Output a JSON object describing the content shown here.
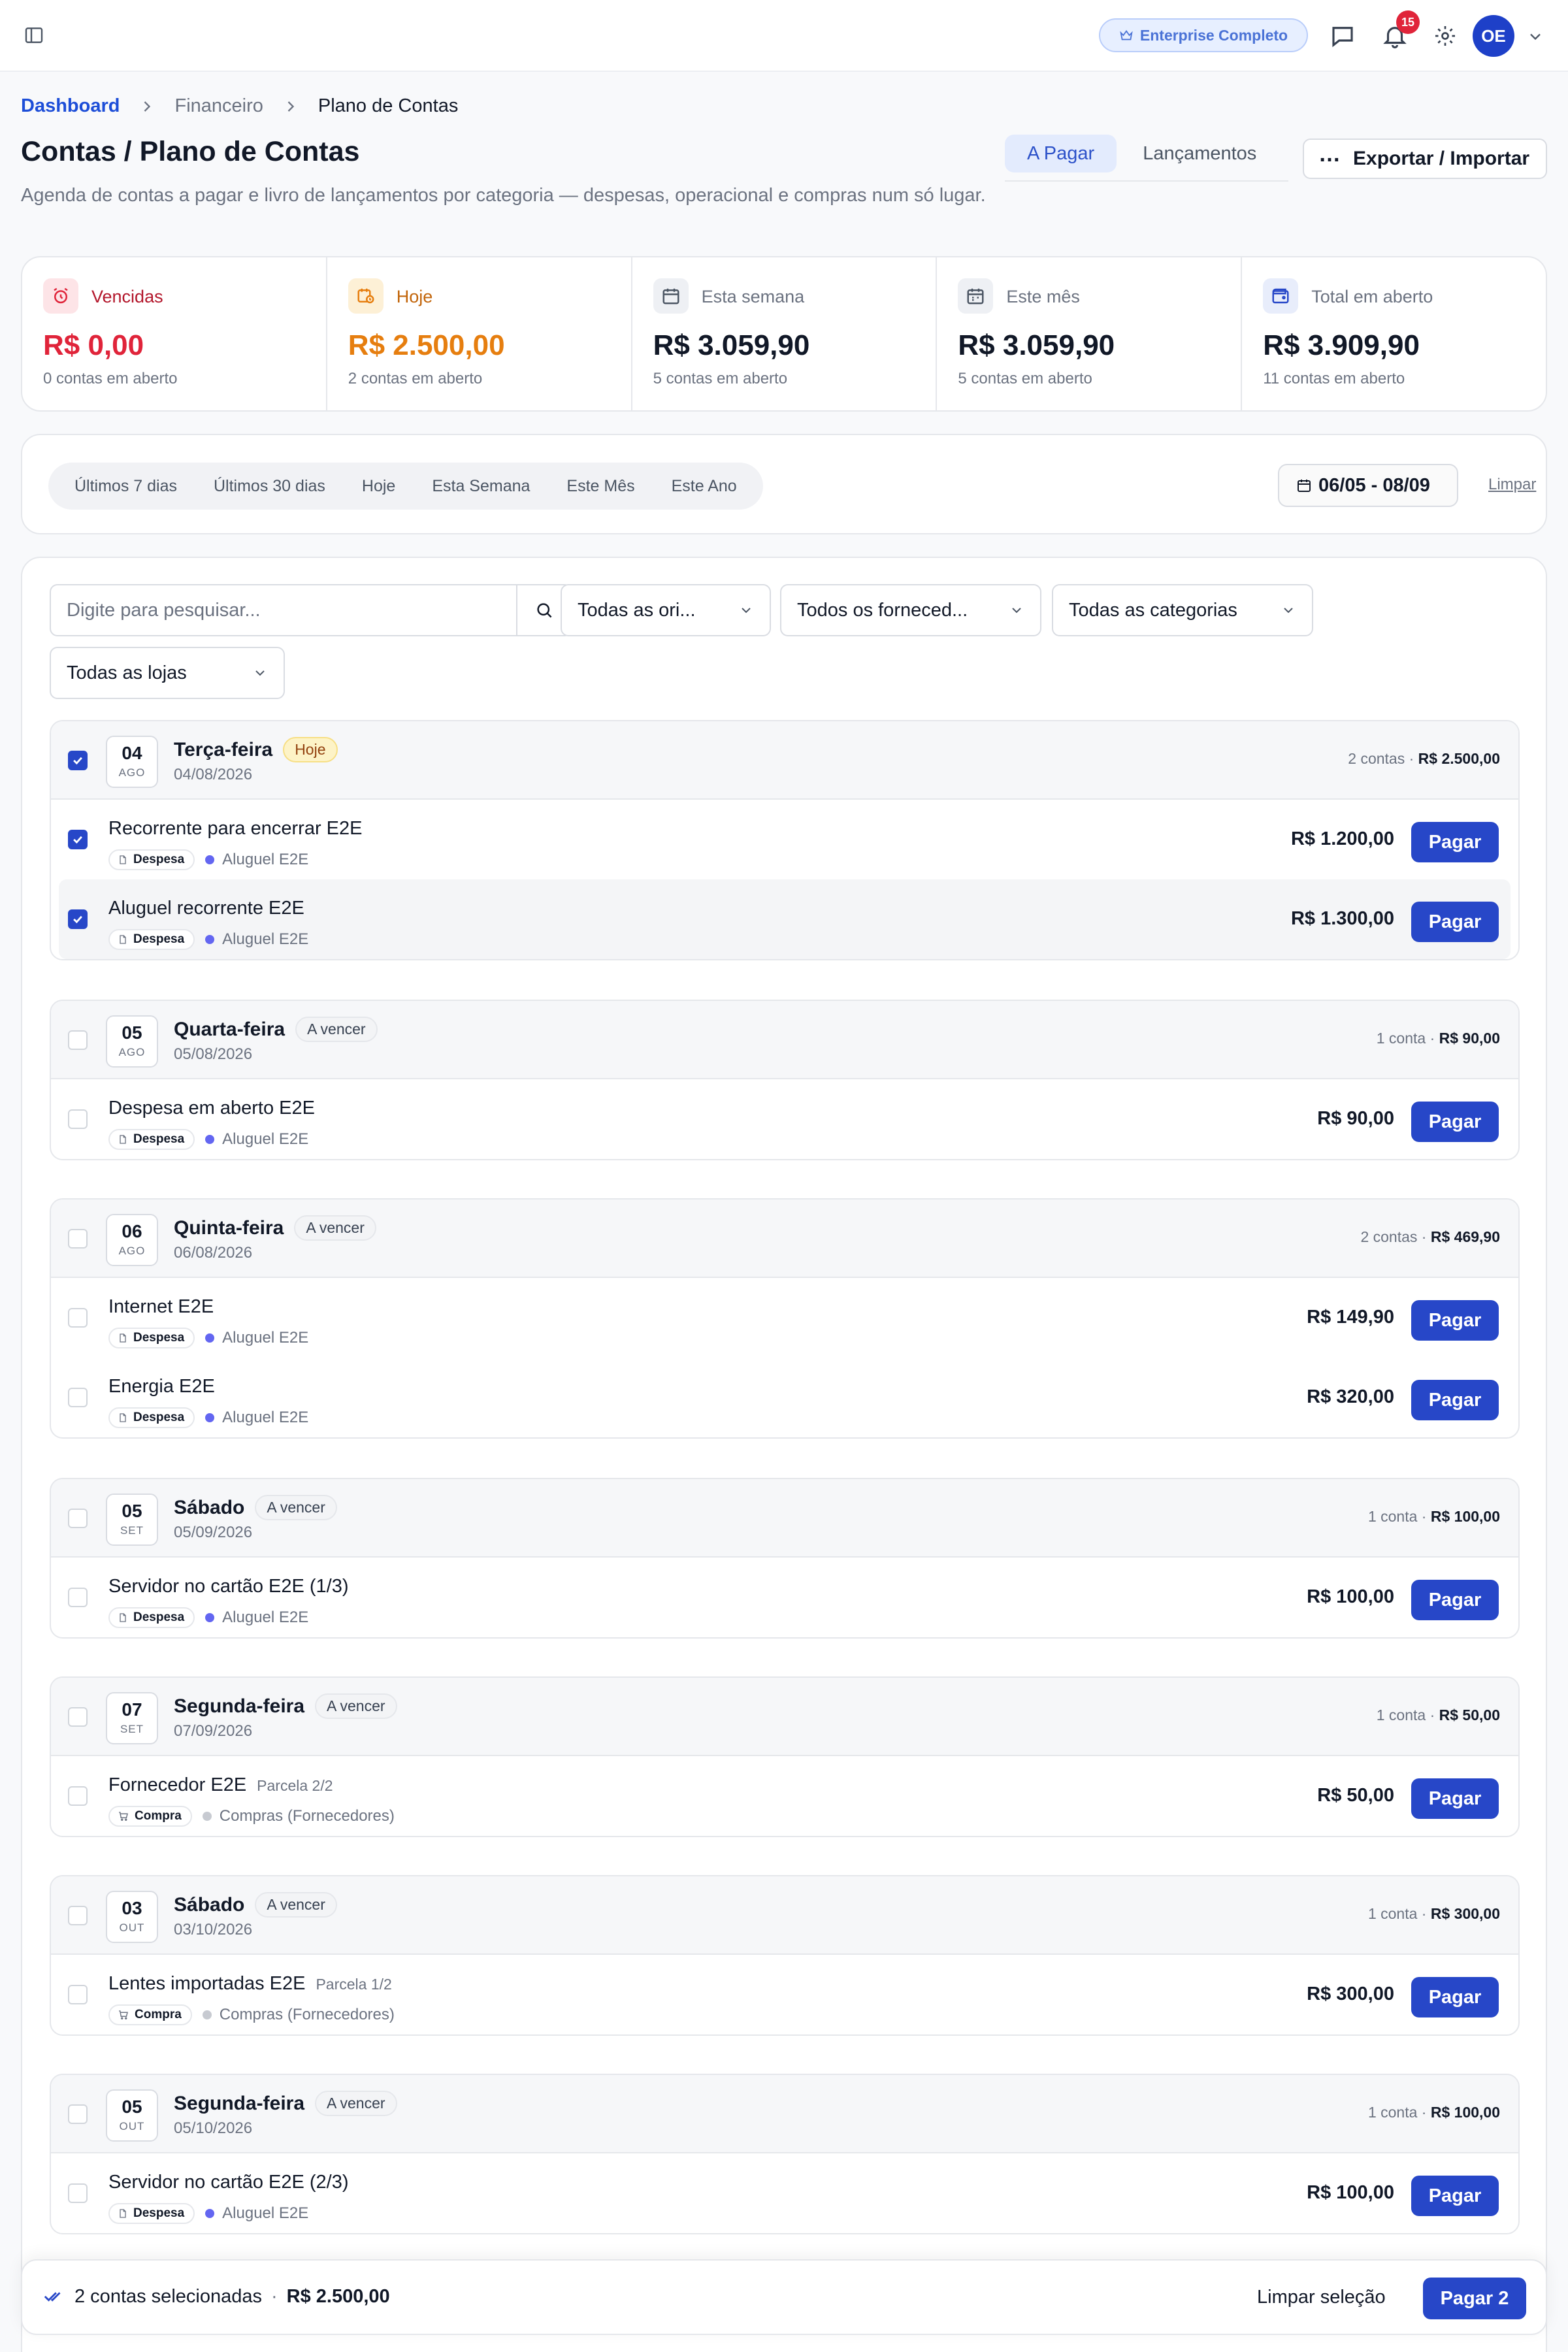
{
  "topbar": {
    "plan_badge": "Enterprise Completo",
    "notification_count": "15",
    "avatar_initials": "OE"
  },
  "breadcrumb": [
    "Dashboard",
    "Financeiro",
    "Plano de Contas"
  ],
  "header": {
    "title": "Contas / Plano de Contas",
    "description": "Agenda de contas a pagar e livro de lançamentos por categoria — despesas, operacional e compras num só lugar.",
    "tabs": [
      {
        "label": "A Pagar",
        "active": true
      },
      {
        "label": "Lançamentos",
        "active": false
      }
    ],
    "export_label": "Exportar / Importar"
  },
  "stats": [
    {
      "label": "Vencidas",
      "value": "R$ 0,00",
      "sub": "0 contas em aberto",
      "icon": "alarm-icon",
      "color": "#e0243a"
    },
    {
      "label": "Hoje",
      "value": "R$ 2.500,00",
      "sub": "2 contas em aberto",
      "icon": "calendar-clock-icon",
      "color": "#e67e0f"
    },
    {
      "label": "Esta semana",
      "value": "R$ 3.059,90",
      "sub": "5 contas em aberto",
      "icon": "calendar-icon",
      "color": "#111827"
    },
    {
      "label": "Este mês",
      "value": "R$ 3.059,90",
      "sub": "5 contas em aberto",
      "icon": "calendar-icon",
      "color": "#111827"
    },
    {
      "label": "Total em aberto",
      "value": "R$ 3.909,90",
      "sub": "11 contas em aberto",
      "icon": "wallet-icon",
      "color": "#111827"
    }
  ],
  "period": {
    "pills": [
      "Últimos 7 dias",
      "Últimos 30 dias",
      "Hoje",
      "Esta Semana",
      "Este Mês",
      "Este Ano"
    ],
    "date_range": "06/05 - 08/09",
    "clear_label": "Limpar"
  },
  "filters": {
    "search_placeholder": "Digite para pesquisar...",
    "origins": "Todas as ori...",
    "suppliers": "Todos os forneced...",
    "categories": "Todas as categorias",
    "stores": "Todas as lojas"
  },
  "days": [
    {
      "day": "04",
      "month": "AGO",
      "weekday": "Terça-feira",
      "status": "Hoje",
      "date": "04/08/2026",
      "count": "2 contas",
      "total": "R$ 2.500,00",
      "checked": true,
      "items": [
        {
          "title": "Recorrente para encerrar E2E",
          "parcel": "",
          "type": "Despesa",
          "category": "Aluguel E2E",
          "amount": "R$ 1.200,00",
          "checked": true
        },
        {
          "title": "Aluguel recorrente E2E",
          "parcel": "",
          "type": "Despesa",
          "category": "Aluguel E2E",
          "amount": "R$ 1.300,00",
          "checked": true
        }
      ]
    },
    {
      "day": "05",
      "month": "AGO",
      "weekday": "Quarta-feira",
      "status": "A vencer",
      "date": "05/08/2026",
      "count": "1 conta",
      "total": "R$ 90,00",
      "checked": false,
      "items": [
        {
          "title": "Despesa em aberto E2E",
          "parcel": "",
          "type": "Despesa",
          "category": "Aluguel E2E",
          "amount": "R$ 90,00",
          "checked": false
        }
      ]
    },
    {
      "day": "06",
      "month": "AGO",
      "weekday": "Quinta-feira",
      "status": "A vencer",
      "date": "06/08/2026",
      "count": "2 contas",
      "total": "R$ 469,90",
      "checked": false,
      "items": [
        {
          "title": "Internet E2E",
          "parcel": "",
          "type": "Despesa",
          "category": "Aluguel E2E",
          "amount": "R$ 149,90",
          "checked": false
        },
        {
          "title": "Energia E2E",
          "parcel": "",
          "type": "Despesa",
          "category": "Aluguel E2E",
          "amount": "R$ 320,00",
          "checked": false
        }
      ]
    },
    {
      "day": "05",
      "month": "SET",
      "weekday": "Sábado",
      "status": "A vencer",
      "date": "05/09/2026",
      "count": "1 conta",
      "total": "R$ 100,00",
      "checked": false,
      "items": [
        {
          "title": "Servidor no cartão E2E (1/3)",
          "parcel": "",
          "type": "Despesa",
          "category": "Aluguel E2E",
          "amount": "R$ 100,00",
          "checked": false
        }
      ]
    },
    {
      "day": "07",
      "month": "SET",
      "weekday": "Segunda-feira",
      "status": "A vencer",
      "date": "07/09/2026",
      "count": "1 conta",
      "total": "R$ 50,00",
      "checked": false,
      "items": [
        {
          "title": "Fornecedor E2E",
          "parcel": "Parcela 2/2",
          "type": "Compra",
          "category": "Compras (Fornecedores)",
          "amount": "R$ 50,00",
          "checked": false
        }
      ]
    },
    {
      "day": "03",
      "month": "OUT",
      "weekday": "Sábado",
      "status": "A vencer",
      "date": "03/10/2026",
      "count": "1 conta",
      "total": "R$ 300,00",
      "checked": false,
      "items": [
        {
          "title": "Lentes importadas E2E",
          "parcel": "Parcela 1/2",
          "type": "Compra",
          "category": "Compras (Fornecedores)",
          "amount": "R$ 300,00",
          "checked": false
        }
      ]
    },
    {
      "day": "05",
      "month": "OUT",
      "weekday": "Segunda-feira",
      "status": "A vencer",
      "date": "05/10/2026",
      "count": "1 conta",
      "total": "R$ 100,00",
      "checked": false,
      "items": [
        {
          "title": "Servidor no cartão E2E (2/3)",
          "parcel": "",
          "type": "Despesa",
          "category": "Aluguel E2E",
          "amount": "R$ 100,00",
          "checked": false
        }
      ]
    }
  ],
  "pay_label": "Pagar",
  "colors": {
    "accent": "#2747c8",
    "category_expense": "#6366f1",
    "category_purchase": "#c7cad1"
  },
  "selection": {
    "count_label": "2 contas selecionadas",
    "separator": "·",
    "total": "R$ 2.500,00",
    "clear_label": "Limpar seleção",
    "pay_label": "Pagar 2"
  }
}
